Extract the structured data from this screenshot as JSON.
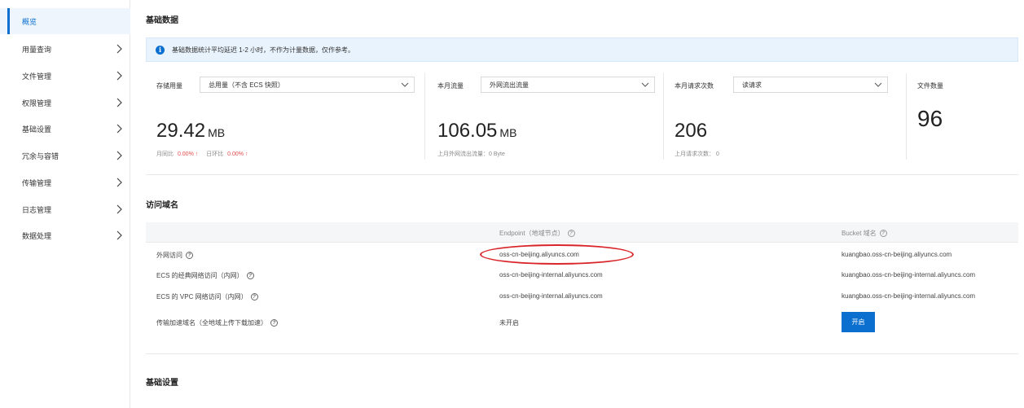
{
  "sidebar": {
    "items": [
      {
        "label": "概览",
        "active": true,
        "has_chevron": false
      },
      {
        "label": "用量查询",
        "active": false,
        "has_chevron": true
      },
      {
        "label": "文件管理",
        "active": false,
        "has_chevron": true
      },
      {
        "label": "权限管理",
        "active": false,
        "has_chevron": true
      },
      {
        "label": "基础设置",
        "active": false,
        "has_chevron": true
      },
      {
        "label": "冗余与容错",
        "active": false,
        "has_chevron": true
      },
      {
        "label": "传输管理",
        "active": false,
        "has_chevron": true
      },
      {
        "label": "日志管理",
        "active": false,
        "has_chevron": true
      },
      {
        "label": "数据处理",
        "active": false,
        "has_chevron": true
      }
    ]
  },
  "basic_data": {
    "title": "基础数据",
    "notice": "基础数据统计平均延迟 1-2 小时，不作为计量数据，仅作参考。",
    "storage": {
      "label": "存储用量",
      "select": "总用量（不含 ECS 快照）",
      "value": "29.42",
      "unit": "MB",
      "mom_label": "月同比",
      "mom_value": "0.00% ↑",
      "dod_label": "日环比",
      "dod_value": "0.00% ↑"
    },
    "traffic": {
      "label": "本月流量",
      "select": "外网流出流量",
      "value": "106.05",
      "unit": "MB",
      "sub": "上月外网流出流量：0 Byte"
    },
    "requests": {
      "label": "本月请求次数",
      "select": "读请求",
      "value": "206",
      "sub": "上月请求次数：  0"
    },
    "files": {
      "label": "文件数量",
      "value": "96"
    }
  },
  "access_domains": {
    "title": "访问域名",
    "columns": {
      "endpoint": "Endpoint（地域节点）",
      "bucket": "Bucket 域名"
    },
    "rows": [
      {
        "name": "外网访问",
        "endpoint": "oss-cn-beijing.aliyuncs.com",
        "bucket": "kuangbao.oss-cn-beijing.aliyuncs.com"
      },
      {
        "name": "ECS 的经典网络访问（内网）",
        "endpoint": "oss-cn-beijing-internal.aliyuncs.com",
        "bucket": "kuangbao.oss-cn-beijing-internal.aliyuncs.com"
      },
      {
        "name": "ECS 的 VPC 网络访问（内网）",
        "endpoint": "oss-cn-beijing-internal.aliyuncs.com",
        "bucket": "kuangbao.oss-cn-beijing-internal.aliyuncs.com"
      },
      {
        "name": "传输加速域名（全地域上传下载加速）",
        "endpoint": "未开启",
        "button": "开启"
      }
    ]
  },
  "basic_settings": {
    "title": "基础设置"
  },
  "colors": {
    "accent": "#0b6fd0",
    "notice_bg": "#e9f3fd",
    "highlight": "#d9252a",
    "trend_up": "#e24b4b"
  }
}
